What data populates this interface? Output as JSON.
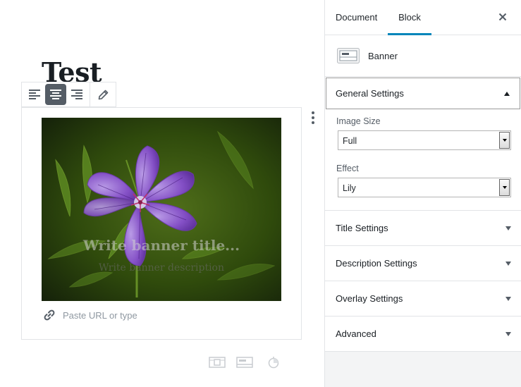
{
  "post": {
    "title": "Test"
  },
  "toolbar": {
    "align_left_label": "Align left",
    "align_center_label": "Align center",
    "align_right_label": "Align right",
    "edit_label": "Edit"
  },
  "banner": {
    "title_placeholder": "Write banner title...",
    "description_placeholder": "Write banner description",
    "url_placeholder": "Paste URL or type"
  },
  "sidebar": {
    "tabs": [
      {
        "label": "Document",
        "active": false
      },
      {
        "label": "Block",
        "active": true
      }
    ],
    "block_card": {
      "name": "Banner",
      "icon": "banner-block-icon"
    },
    "panels": [
      {
        "title": "General Settings",
        "open": true,
        "fields": [
          {
            "label": "Image Size",
            "value": "Full"
          },
          {
            "label": "Effect",
            "value": "Lily"
          }
        ]
      },
      {
        "title": "Title Settings",
        "open": false
      },
      {
        "title": "Description Settings",
        "open": false
      },
      {
        "title": "Overlay Settings",
        "open": false
      },
      {
        "title": "Advanced",
        "open": false
      }
    ]
  },
  "colors": {
    "accent": "#0085ba",
    "toolbar_active": "#555d66",
    "border": "#e2e4e7",
    "sidebar_bg": "#f3f4f5"
  }
}
